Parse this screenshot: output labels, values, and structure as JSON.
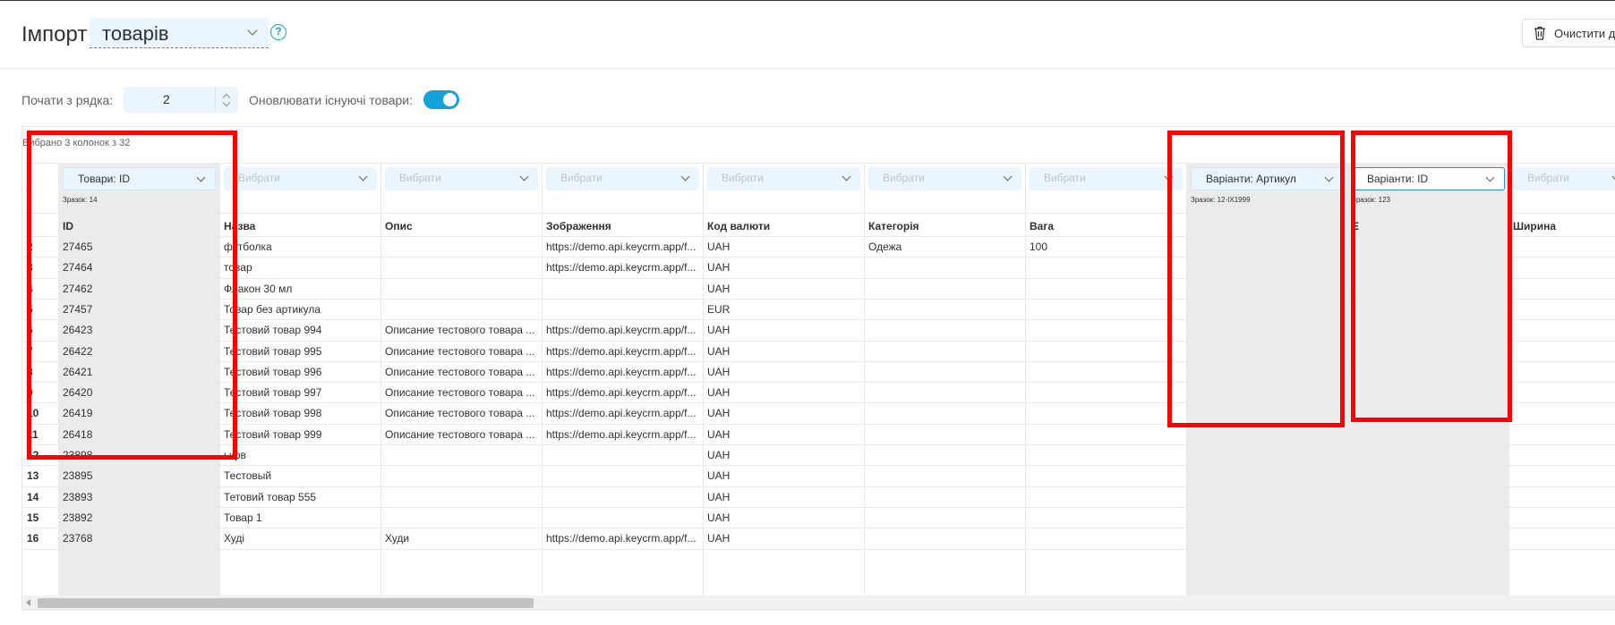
{
  "header": {
    "title": "Імпорт",
    "import_type": "товарів",
    "help_symbol": "?",
    "clear_button_label": "Очистити да"
  },
  "options": {
    "start_row_label": "Почати з рядка:",
    "start_row_value": "2",
    "update_label": "Оновлювати існуючі товари:",
    "update_enabled": true
  },
  "table": {
    "selected_info": "Вибрано 3 колонок з 32",
    "row_num_header": "#",
    "columns": [
      {
        "mapping": "Товари: ID",
        "sample": "Зразок: 14",
        "header": "ID"
      },
      {
        "mapping": "Вибрати",
        "sample": "",
        "header": "Назва"
      },
      {
        "mapping": "Вибрати",
        "sample": "",
        "header": "Опис"
      },
      {
        "mapping": "Вибрати",
        "sample": "",
        "header": "Зображення"
      },
      {
        "mapping": "Вибрати",
        "sample": "",
        "header": "Код валюти"
      },
      {
        "mapping": "Вибрати",
        "sample": "",
        "header": "Категорія"
      },
      {
        "mapping": "Вибрати",
        "sample": "",
        "header": "Вага"
      },
      {
        "mapping": "Варіанти: Артикул",
        "sample": "Зразок: 12-IX1999",
        "header": ""
      },
      {
        "mapping": "Варіанти: ID",
        "sample": "Зразок: 123",
        "header": "E"
      },
      {
        "mapping": "Вибрати",
        "sample": "",
        "header": "Ширина"
      }
    ],
    "rows": [
      {
        "num": "2",
        "cells": [
          "27465",
          "футболка",
          "",
          "https://demo.api.keycrm.app/f...",
          "UAH",
          "Одежа",
          "100"
        ]
      },
      {
        "num": "3",
        "cells": [
          "27464",
          "товар",
          "",
          "https://demo.api.keycrm.app/f...",
          "UAH",
          "",
          ""
        ]
      },
      {
        "num": "4",
        "cells": [
          "27462",
          "Флакон 30 мл",
          "",
          "",
          "UAH",
          "",
          ""
        ]
      },
      {
        "num": "5",
        "cells": [
          "27457",
          "Товар без артикула",
          "",
          "",
          "EUR",
          "",
          ""
        ]
      },
      {
        "num": "6",
        "cells": [
          "26423",
          "Тестовий товар 994",
          "Описание тестового товара ...",
          "https://demo.api.keycrm.app/f...",
          "UAH",
          "",
          ""
        ]
      },
      {
        "num": "7",
        "cells": [
          "26422",
          "Тестовий товар 995",
          "Описание тестового товара ...",
          "https://demo.api.keycrm.app/f...",
          "UAH",
          "",
          ""
        ]
      },
      {
        "num": "8",
        "cells": [
          "26421",
          "Тестовий товар 996",
          "Описание тестового товара ...",
          "https://demo.api.keycrm.app/f...",
          "UAH",
          "",
          ""
        ]
      },
      {
        "num": "9",
        "cells": [
          "26420",
          "Тестовий товар 997",
          "Описание тестового товара ...",
          "https://demo.api.keycrm.app/f...",
          "UAH",
          "",
          ""
        ]
      },
      {
        "num": "10",
        "cells": [
          "26419",
          "Тестовий товар 998",
          "Описание тестового товара ...",
          "https://demo.api.keycrm.app/f...",
          "UAH",
          "",
          ""
        ]
      },
      {
        "num": "11",
        "cells": [
          "26418",
          "Тестовий товар 999",
          "Описание тестового товара ...",
          "https://demo.api.keycrm.app/f...",
          "UAH",
          "",
          ""
        ]
      },
      {
        "num": "12",
        "cells": [
          "23898",
          "ыфв",
          "",
          "",
          "UAH",
          "",
          ""
        ]
      },
      {
        "num": "13",
        "cells": [
          "23895",
          "Тестовый",
          "",
          "",
          "UAH",
          "",
          ""
        ]
      },
      {
        "num": "14",
        "cells": [
          "23893",
          "Тетовий товар 555",
          "",
          "",
          "UAH",
          "",
          ""
        ]
      },
      {
        "num": "15",
        "cells": [
          "23892",
          "Товар 1",
          "",
          "",
          "UAH",
          "",
          ""
        ]
      },
      {
        "num": "16",
        "cells": [
          "23768",
          "Худі",
          "Худи",
          "https://demo.api.keycrm.app/f...",
          "UAH",
          "",
          ""
        ]
      }
    ]
  },
  "colors": {
    "accent": "#14a3d9",
    "selected_column_bg": "#ebebeb",
    "annotation": "#ff0000"
  }
}
